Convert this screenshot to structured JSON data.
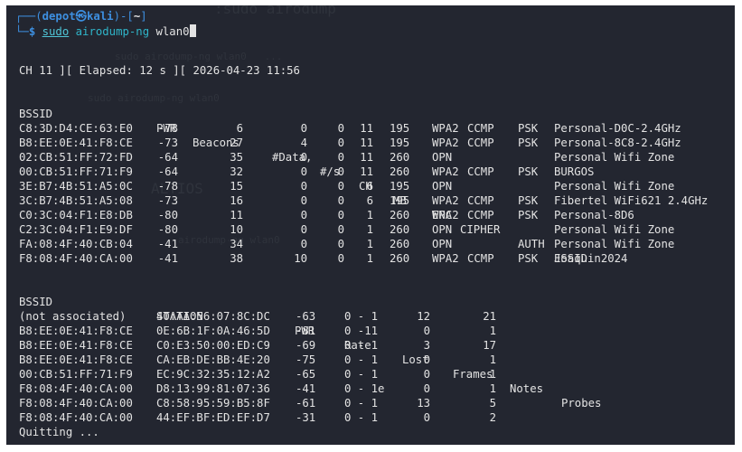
{
  "prompt": {
    "user": "depot",
    "skull": "㉿",
    "host": "kali",
    "dir": "~",
    "command_tool": "sudo",
    "command_bin": "airodump-ng",
    "command_arg": "wlan0"
  },
  "status": {
    "text": "CH 11 ][ Elapsed: 12 s ][ 2026-04-23 11:56"
  },
  "ap_table": {
    "headers": [
      "BSSID",
      "PWR",
      "Beacons",
      "#Data,",
      "#/s",
      "CH",
      "MB",
      "ENC",
      "CIPHER",
      "AUTH",
      "ESSID"
    ],
    "rows": [
      {
        "bssid": "C8:3D:D4:CE:63:E0",
        "pwr": "-78",
        "beacons": "6",
        "data": "0",
        "ps": "0",
        "ch": "11",
        "mb": "195",
        "enc": "WPA2",
        "cipher": "CCMP",
        "auth": "PSK",
        "essid": "Personal-D0C-2.4GHz"
      },
      {
        "bssid": "B8:EE:0E:41:F8:CE",
        "pwr": "-73",
        "beacons": "27",
        "data": "4",
        "ps": "0",
        "ch": "11",
        "mb": "195",
        "enc": "WPA2",
        "cipher": "CCMP",
        "auth": "PSK",
        "essid": "Personal-8C8-2.4GHz"
      },
      {
        "bssid": "02:CB:51:FF:72:FD",
        "pwr": "-64",
        "beacons": "35",
        "data": "0",
        "ps": "0",
        "ch": "11",
        "mb": "260",
        "enc": "OPN",
        "cipher": "",
        "auth": "",
        "essid": "Personal Wifi Zone"
      },
      {
        "bssid": "00:CB:51:FF:71:F9",
        "pwr": "-64",
        "beacons": "32",
        "data": "0",
        "ps": "0",
        "ch": "11",
        "mb": "260",
        "enc": "WPA2",
        "cipher": "CCMP",
        "auth": "PSK",
        "essid": "BURGOS"
      },
      {
        "bssid": "3E:B7:4B:51:A5:0C",
        "pwr": "-78",
        "beacons": "15",
        "data": "0",
        "ps": "0",
        "ch": "6",
        "mb": "195",
        "enc": "OPN",
        "cipher": "",
        "auth": "",
        "essid": "Personal Wifi Zone"
      },
      {
        "bssid": "3C:B7:4B:51:A5:08",
        "pwr": "-73",
        "beacons": "16",
        "data": "0",
        "ps": "0",
        "ch": "6",
        "mb": "195",
        "enc": "WPA2",
        "cipher": "CCMP",
        "auth": "PSK",
        "essid": "Fibertel WiFi621 2.4GHz"
      },
      {
        "bssid": "C0:3C:04:F1:E8:DB",
        "pwr": "-80",
        "beacons": "11",
        "data": "0",
        "ps": "0",
        "ch": "1",
        "mb": "260",
        "enc": "WPA2",
        "cipher": "CCMP",
        "auth": "PSK",
        "essid": "Personal-8D6"
      },
      {
        "bssid": "C2:3C:04:F1:E9:DF",
        "pwr": "-80",
        "beacons": "10",
        "data": "0",
        "ps": "0",
        "ch": "1",
        "mb": "260",
        "enc": "OPN",
        "cipher": "",
        "auth": "",
        "essid": "Personal Wifi Zone"
      },
      {
        "bssid": "FA:08:4F:40:CB:04",
        "pwr": "-41",
        "beacons": "34",
        "data": "0",
        "ps": "0",
        "ch": "1",
        "mb": "260",
        "enc": "OPN",
        "cipher": "",
        "auth": "",
        "essid": "Personal Wifi Zone"
      },
      {
        "bssid": "F8:08:4F:40:CA:00",
        "pwr": "-41",
        "beacons": "38",
        "data": "10",
        "ps": "0",
        "ch": "1",
        "mb": "260",
        "enc": "WPA2",
        "cipher": "CCMP",
        "auth": "PSK",
        "essid": "Joaquin2024"
      }
    ]
  },
  "sta_table": {
    "headers": [
      "BSSID",
      "STATION",
      "PWR",
      "Rate",
      "Lost",
      "Frames",
      "Notes",
      "Probes"
    ],
    "rows": [
      {
        "bssid": "(not associated)",
        "station": "40:AA:56:07:8C:DC",
        "pwr": "-63",
        "rate": "0 - 1",
        "lost": "12",
        "frames": "21"
      },
      {
        "bssid": "B8:EE:0E:41:F8:CE",
        "station": "0E:6B:1F:0A:46:5D",
        "pwr": "-81",
        "rate": "0 -11",
        "lost": "0",
        "frames": "1"
      },
      {
        "bssid": "B8:EE:0E:41:F8:CE",
        "station": "C0:E3:50:00:ED:C9",
        "pwr": "-69",
        "rate": "0 - 1",
        "lost": "3",
        "frames": "17"
      },
      {
        "bssid": "B8:EE:0E:41:F8:CE",
        "station": "CA:EB:DE:BB:4E:20",
        "pwr": "-75",
        "rate": "0 - 1",
        "lost": "0",
        "frames": "1"
      },
      {
        "bssid": "00:CB:51:FF:71:F9",
        "station": "EC:9C:32:35:12:A2",
        "pwr": "-65",
        "rate": "0 - 1",
        "lost": "0",
        "frames": "1"
      },
      {
        "bssid": "F8:08:4F:40:CA:00",
        "station": "D8:13:99:81:07:36",
        "pwr": "-41",
        "rate": "0 - 1e",
        "lost": "0",
        "frames": "1"
      },
      {
        "bssid": "F8:08:4F:40:CA:00",
        "station": "C8:58:95:59:B5:8F",
        "pwr": "-61",
        "rate": "0 - 1",
        "lost": "13",
        "frames": "5"
      },
      {
        "bssid": "F8:08:4F:40:CA:00",
        "station": "44:EF:BF:ED:EF:D7",
        "pwr": "-31",
        "rate": "0 - 1",
        "lost": "0",
        "frames": "2"
      }
    ]
  },
  "footer": {
    "text": "Quitting ..."
  }
}
